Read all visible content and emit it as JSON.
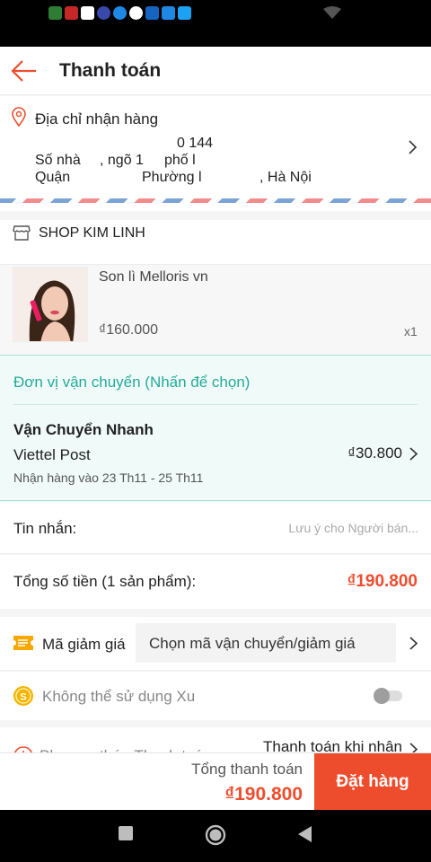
{
  "status_bar": {
    "notification_icons": [
      {
        "name": "shield-app-icon",
        "color": "#2e7d32"
      },
      {
        "name": "grab-app-icon",
        "color": "#c62828"
      },
      {
        "name": "grab-icon",
        "color": "#ffffff"
      },
      {
        "name": "chat-app-icon",
        "color": "#3949ab"
      },
      {
        "name": "messenger-icon",
        "color": "#1e88e5"
      },
      {
        "name": "google-icon",
        "color": "#ffffff"
      },
      {
        "name": "cloud-icon",
        "color": "#1565c0"
      },
      {
        "name": "vpn-shield-icon",
        "color": "#1e88e5"
      },
      {
        "name": "twitter-icon",
        "color": "#1da1f2"
      }
    ],
    "wifi_icon": "wifi-icon"
  },
  "header": {
    "title": "Thanh toán"
  },
  "address": {
    "title": "Địa chỉ nhận hàng",
    "line_top": "0 144",
    "line1_a": "Số nhà",
    "line1_b": ", ngõ 1",
    "line1_c": "phố l",
    "line2_a": "Quận",
    "line2_b": "Phường l",
    "line2_c": ", Hà Nội"
  },
  "shop": {
    "name": "SHOP KIM LINH"
  },
  "product": {
    "name": "Son lì Melloris vn",
    "price": "₫160.000",
    "quantity": "x1"
  },
  "shipping": {
    "select_prompt": "Đơn vị vận chuyển (Nhấn để chọn)",
    "method": "Vận Chuyển Nhanh",
    "carrier": "Viettel Post",
    "fee": "₫30.800",
    "eta": "Nhận hàng vào 23 Th11 - 25 Th11"
  },
  "message": {
    "label": "Tin nhắn:",
    "placeholder": "Lưu ý cho Người bán..."
  },
  "order_total": {
    "label": "Tổng số tiền (1 sản phẩm):",
    "value": "₫190.800"
  },
  "voucher": {
    "label": "Mã giảm giá",
    "select_text": "Chọn mã vận chuyển/giảm giá"
  },
  "coins": {
    "label": "Không thể sử dụng Xu",
    "enabled": false
  },
  "payment": {
    "label": "Phương thức Thanh toán",
    "value": "Thanh toán khi nhận"
  },
  "checkout": {
    "total_label": "Tổng thanh toán",
    "total_amount": "₫190.800",
    "button": "Đặt hàng"
  },
  "colors": {
    "accent": "#ee4d2d",
    "shipping_teal": "#26aa99",
    "shipping_bg": "#f0fbf9"
  }
}
